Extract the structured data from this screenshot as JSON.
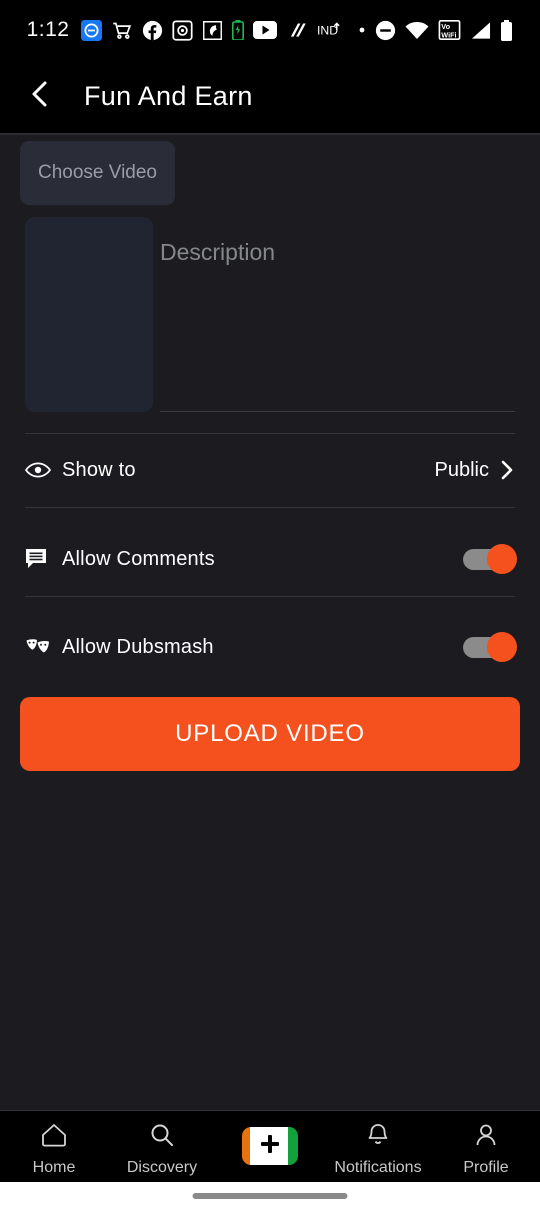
{
  "statusbar": {
    "time": "1:12",
    "carrier": "IND",
    "icons": [
      "messenger-icon",
      "shopping-cart-icon",
      "facebook-icon",
      "app-badge-icon",
      "app-bird-icon",
      "battery-saver-icon",
      "youtube-icon",
      "app-slash-icon",
      "carrier-label",
      "dot-icon",
      "do-not-disturb-icon",
      "wifi-icon",
      "volte-wifi-icon",
      "signal-icon",
      "battery-icon"
    ]
  },
  "appbar": {
    "back_label": "back",
    "title": "Fun And Earn"
  },
  "form": {
    "choose_video_label": "Choose Video",
    "thumbnail_label": "video thumbnail placeholder",
    "description_placeholder": "Description",
    "description_value": ""
  },
  "settings": {
    "show_to": {
      "icon": "eye-icon",
      "label": "Show to",
      "value": "Public",
      "chevron": "chevron-right-icon"
    },
    "allow_comments": {
      "icon": "comment-icon",
      "label": "Allow Comments",
      "enabled": true
    },
    "allow_dubsmash": {
      "icon": "theater-masks-icon",
      "label": "Allow Dubsmash",
      "enabled": true
    }
  },
  "actions": {
    "upload_label": "UPLOAD VIDEO"
  },
  "bottomnav": {
    "items": [
      {
        "label": "Home",
        "icon": "home-icon"
      },
      {
        "label": "Discovery",
        "icon": "search-icon"
      },
      {
        "label": "",
        "icon": "plus-icon"
      },
      {
        "label": "Notifications",
        "icon": "bell-icon"
      },
      {
        "label": "Profile",
        "icon": "person-icon"
      }
    ]
  },
  "colors": {
    "accent": "#f4511e",
    "background": "#1c1c20",
    "bar": "#000000",
    "thumb_placeholder": "#212531",
    "chooser": "#2a2d38",
    "toggle_track": "#8b8b8b",
    "flag_saffron": "#e8720f",
    "flag_green": "#14a03c"
  }
}
